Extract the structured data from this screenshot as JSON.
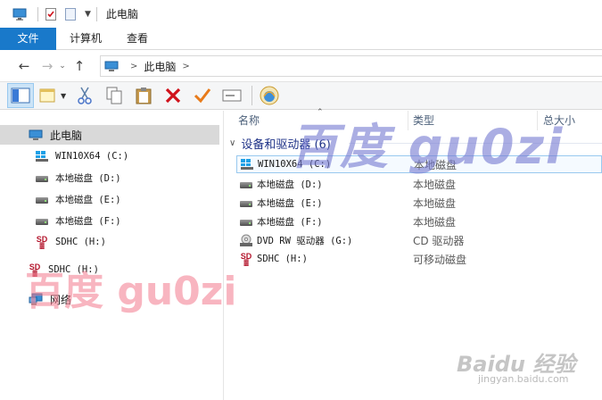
{
  "window": {
    "title": "此电脑"
  },
  "ribbon": {
    "tabs": [
      "文件",
      "计算机",
      "查看"
    ]
  },
  "address": {
    "crumbs": [
      "此电脑"
    ]
  },
  "nav_pane": {
    "items": [
      {
        "label": "此电脑",
        "icon": "computer-icon"
      },
      {
        "label": "WIN10X64 (C:)",
        "icon": "windows-drive-icon"
      },
      {
        "label": "本地磁盘 (D:)",
        "icon": "hard-drive-icon"
      },
      {
        "label": "本地磁盘 (E:)",
        "icon": "hard-drive-icon"
      },
      {
        "label": "本地磁盘 (F:)",
        "icon": "hard-drive-icon"
      },
      {
        "label": "SDHC (H:)",
        "icon": "sd-card-icon"
      },
      {
        "label": "SDHC (H:)",
        "icon": "sd-card-icon"
      },
      {
        "label": "网络",
        "icon": "network-icon"
      }
    ]
  },
  "columns": {
    "name": "名称",
    "type": "类型",
    "size": "总大小"
  },
  "group": {
    "label": "设备和驱动器 (6)"
  },
  "drives": [
    {
      "name": "WIN10X64 (C:)",
      "type": "本地磁盘",
      "icon": "windows-drive-icon"
    },
    {
      "name": "本地磁盘 (D:)",
      "type": "本地磁盘",
      "icon": "hard-drive-icon"
    },
    {
      "name": "本地磁盘 (E:)",
      "type": "本地磁盘",
      "icon": "hard-drive-icon"
    },
    {
      "name": "本地磁盘 (F:)",
      "type": "本地磁盘",
      "icon": "hard-drive-icon"
    },
    {
      "name": "DVD RW 驱动器 (G:)",
      "type": "CD 驱动器",
      "icon": "dvd-drive-icon"
    },
    {
      "name": "SDHC (H:)",
      "type": "可移动磁盘",
      "icon": "sd-card-icon"
    }
  ],
  "watermarks": {
    "handwritten": "百度 gu0zi",
    "pink": "百度 gu0zi",
    "baidu_logo": "Baidu 经验",
    "baidu_url": "jingyan.baidu.com"
  },
  "colors": {
    "accent": "#1979ca",
    "selection": "#cce4f7",
    "delete_red": "#d0121b",
    "check_orange": "#e87b1b"
  }
}
